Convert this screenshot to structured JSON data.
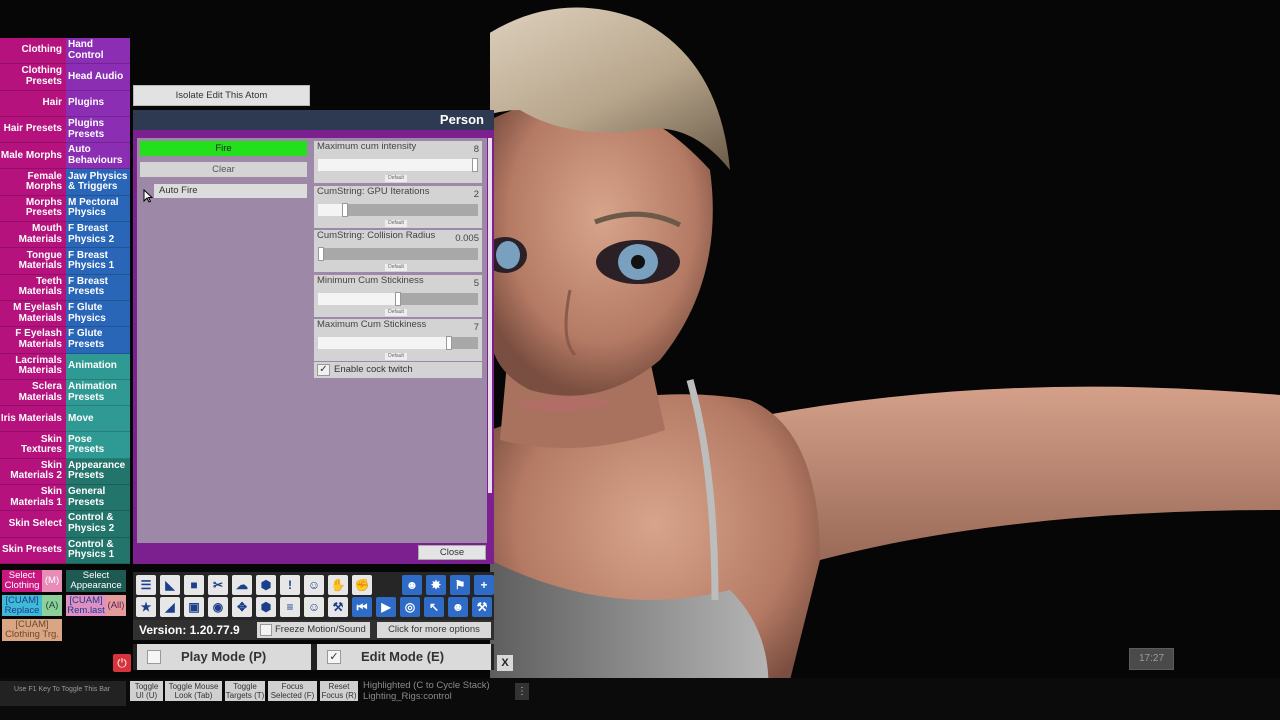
{
  "tabs_left": [
    {
      "label": "Clothing",
      "color": "#b5127e"
    },
    {
      "label": "Clothing Presets",
      "color": "#b5127e"
    },
    {
      "label": "Hair",
      "color": "#b5127e"
    },
    {
      "label": "Hair Presets",
      "color": "#b5127e"
    },
    {
      "label": "Male Morphs",
      "color": "#b5127e"
    },
    {
      "label": "Female Morphs",
      "color": "#b5127e"
    },
    {
      "label": "Morphs Presets",
      "color": "#b5127e"
    },
    {
      "label": "Mouth Materials",
      "color": "#b5127e"
    },
    {
      "label": "Tongue Materials",
      "color": "#b5127e"
    },
    {
      "label": "Teeth Materials",
      "color": "#b5127e"
    },
    {
      "label": "M Eyelash Materials",
      "color": "#b5127e"
    },
    {
      "label": "F Eyelash Materials",
      "color": "#b5127e"
    },
    {
      "label": "Lacrimals Materials",
      "color": "#b5127e"
    },
    {
      "label": "Sclera Materials",
      "color": "#b5127e"
    },
    {
      "label": "Iris Materials",
      "color": "#b5127e"
    },
    {
      "label": "Skin Textures",
      "color": "#b5127e"
    },
    {
      "label": "Skin Materials 2",
      "color": "#b5127e"
    },
    {
      "label": "Skin Materials 1",
      "color": "#b5127e"
    },
    {
      "label": "Skin Select",
      "color": "#b5127e"
    },
    {
      "label": "Skin Presets",
      "color": "#b5127e"
    }
  ],
  "tabs_right": [
    {
      "label": "Hand Control",
      "color": "#8b2eb3"
    },
    {
      "label": "Head Audio",
      "color": "#8b2eb3"
    },
    {
      "label": "Plugins",
      "color": "#8b2eb3"
    },
    {
      "label": "Plugins Presets",
      "color": "#8b2eb3"
    },
    {
      "label": "Auto Behaviours",
      "color": "#8b2eb3"
    },
    {
      "label": "Jaw Physics & Triggers",
      "color": "#2a66b8"
    },
    {
      "label": "M Pectoral Physics",
      "color": "#2a66b8"
    },
    {
      "label": "F Breast Physics 2",
      "color": "#2a66b8"
    },
    {
      "label": "F Breast Physics 1",
      "color": "#2a66b8"
    },
    {
      "label": "F Breast Presets",
      "color": "#2a66b8"
    },
    {
      "label": "F Glute Physics",
      "color": "#2a66b8"
    },
    {
      "label": "F Glute Presets",
      "color": "#2a66b8"
    },
    {
      "label": "Animation",
      "color": "#2f9a93"
    },
    {
      "label": "Animation Presets",
      "color": "#2f9a93"
    },
    {
      "label": "Move",
      "color": "#2f9a93"
    },
    {
      "label": "Pose Presets",
      "color": "#2f9a93"
    },
    {
      "label": "Appearance Presets",
      "color": "#23756b"
    },
    {
      "label": "General Presets",
      "color": "#23756b"
    },
    {
      "label": "Control & Physics 2",
      "color": "#23756b"
    },
    {
      "label": "Control & Physics 1",
      "color": "#23756b"
    }
  ],
  "quick_buttons": {
    "select_clothing": "Select Clothing",
    "m_key": "(M)",
    "select_appearance": "Select Appearance",
    "cuam_replace": "[CUAM] Replace",
    "a_key": "(A)",
    "cuam_remlast": "[CUAM] Rem.last",
    "all_key": "(All)",
    "cuam_clothing_trg": "[CUAM] Clothing Trg."
  },
  "isolate_button": "Isolate Edit This Atom",
  "panel": {
    "title": "Person",
    "fire": "Fire",
    "clear": "Clear",
    "auto_fire": "Auto Fire",
    "enable_twitch": "Enable cock twitch",
    "enable_twitch_checked": true,
    "close": "Close",
    "default_label": "Default",
    "sliders": [
      {
        "label": "Maximum cum intensity",
        "value": "8",
        "fraction": 1.0
      },
      {
        "label": "CumString: GPU Iterations",
        "value": "2",
        "fraction": 0.17
      },
      {
        "label": "CumString: Collision Radius",
        "value": "0.005",
        "fraction": 0.02
      },
      {
        "label": "Minimum Cum Stickiness",
        "value": "5",
        "fraction": 0.5
      },
      {
        "label": "Maximum Cum Stickiness",
        "value": "7",
        "fraction": 0.82
      }
    ]
  },
  "toolbar_icons": [
    [
      "menu-icon",
      "☰"
    ],
    [
      "scene-load-icon",
      "◣"
    ],
    [
      "folder-icon",
      "■"
    ],
    [
      "cut-icon",
      "✂"
    ],
    [
      "cloud-upload-icon",
      "☁"
    ],
    [
      "cube-icon",
      "⬢"
    ],
    [
      "alert-icon",
      "!"
    ],
    [
      "person-add-icon",
      "☺"
    ],
    [
      "hand-icon",
      "✋"
    ],
    [
      "hand-grab-icon",
      "✊"
    ],
    [
      "person-blue-icon",
      "☻"
    ],
    [
      "unity-icon",
      "✸"
    ],
    [
      "flag-icon",
      "⚑"
    ],
    [
      "plus-icon",
      "+"
    ],
    [
      "star-icon",
      "★"
    ],
    [
      "scene-save-icon",
      "◢"
    ],
    [
      "camera-folder-icon",
      "▣"
    ],
    [
      "camera-icon",
      "◉"
    ],
    [
      "network-icon",
      "✥"
    ],
    [
      "package-icon",
      "⬢"
    ],
    [
      "document-icon",
      "≡"
    ],
    [
      "person-edit-icon",
      "☺"
    ],
    [
      "wrench-hand-icon",
      "⚒"
    ],
    [
      "skip-back-icon",
      "⏮"
    ],
    [
      "play-icon",
      "▶"
    ],
    [
      "target-icon",
      "◎"
    ],
    [
      "pointer-icon",
      "↖"
    ],
    [
      "people-icon",
      "☻"
    ],
    [
      "tools-icon",
      "⚒"
    ]
  ],
  "version": "Version: 1.20.77.9",
  "freeze_motion": "Freeze Motion/Sound",
  "more_options": "Click for more options",
  "play_mode": "Play Mode (P)",
  "edit_mode": "Edit Mode (E)",
  "edit_mode_checked": true,
  "x_button": "X",
  "f1_hint": "Use F1 Key To Toggle This Bar",
  "bottom_buttons": [
    "Toggle UI (U)",
    "Toggle Mouse Look (Tab)",
    "Toggle Targets (T)",
    "Focus Selected (F)",
    "Reset Focus (R)"
  ],
  "highlighted": "Highlighted (C to Cycle Stack)",
  "highlighted_sub": "Lighting_Rigs:control",
  "clock": "17:27",
  "colors": {
    "panel_bg": "#7c2090",
    "panel_header": "#2d3a52",
    "fire_green": "#22e01c"
  }
}
